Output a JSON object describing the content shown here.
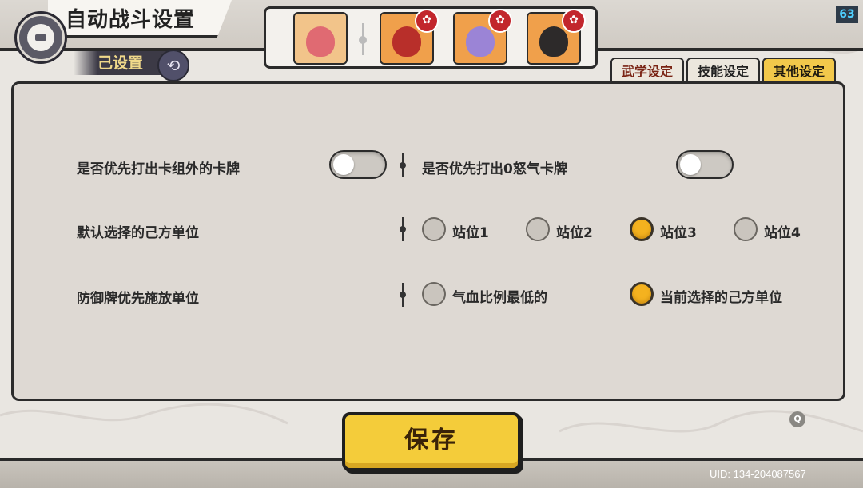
{
  "header": {
    "title": "自动战斗设置",
    "preset_label": "己设置",
    "level": "63"
  },
  "heroes": [
    {
      "name": "hero-1",
      "badge": "",
      "color": "#f29b5a"
    },
    {
      "name": "hero-2",
      "badge": "✿",
      "color": "#c33a2f"
    },
    {
      "name": "hero-3",
      "badge": "✿",
      "color": "#8c7bd0"
    },
    {
      "name": "hero-4",
      "badge": "✿",
      "color": "#2f7a3e"
    }
  ],
  "tabs": [
    {
      "label": "武学设定",
      "active": false
    },
    {
      "label": "技能设定",
      "active": false
    },
    {
      "label": "其他设定",
      "active": true
    }
  ],
  "settings": {
    "row1": {
      "left_label": "是否优先打出卡组外的卡牌",
      "left_toggle": false,
      "right_label": "是否优先打出0怒气卡牌",
      "right_toggle": false
    },
    "row2": {
      "label": "默认选择的己方单位",
      "options": [
        "站位1",
        "站位2",
        "站位3",
        "站位4"
      ],
      "selected": "站位3"
    },
    "row3": {
      "label": "防御牌优先施放单位",
      "options": [
        "气血比例最低的",
        "当前选择的己方单位"
      ],
      "selected": "当前选择的己方单位"
    }
  },
  "save_label": "保存",
  "help_icon": "Q",
  "uid": "UID:  134-204087567",
  "colors": {
    "accent_yellow": "#f4cc3a",
    "panel_bg": "#ded9d3",
    "dark_line": "#2b2b2b"
  }
}
